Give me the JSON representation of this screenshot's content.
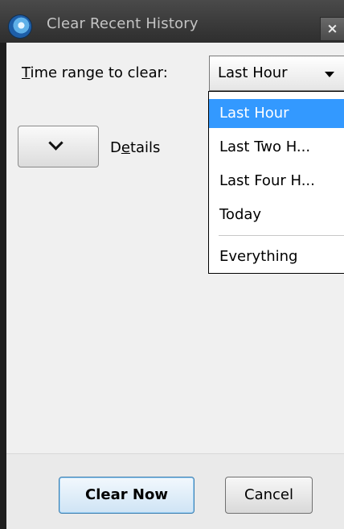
{
  "window": {
    "title": "Clear Recent History",
    "close_glyph": "×",
    "icon": "browser-globe-icon"
  },
  "time_range": {
    "label_access_key": "T",
    "label_rest": "ime range to clear:",
    "selected": "Last Hour",
    "options": [
      "Last Hour",
      "Last Two H...",
      "Last Four H...",
      "Today",
      "Everything"
    ]
  },
  "details": {
    "label_before": "D",
    "label_access_key": "e",
    "label_after": "tails",
    "icon": "chevron-down-icon"
  },
  "buttons": {
    "clear_now": "Clear Now",
    "cancel": "Cancel"
  },
  "colors": {
    "selection": "#3399ff",
    "titlebar": "#3a3a3a",
    "dialog_bg": "#f0f0f0"
  }
}
